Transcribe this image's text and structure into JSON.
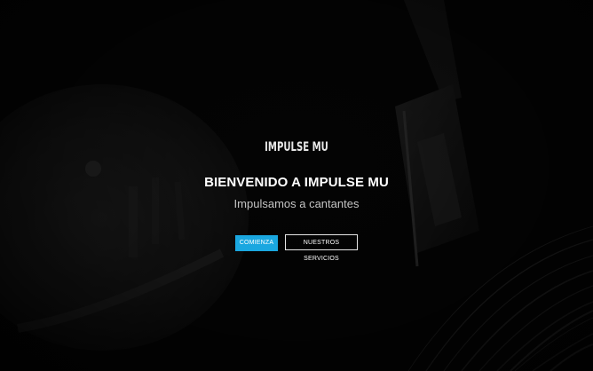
{
  "hero": {
    "logo_text": "IMPULSE MU",
    "headline": "BIENVENIDO A IMPULSE MU",
    "subheadline": "Impulsamos a cantantes",
    "primary_button_label": "COMIENZA",
    "secondary_button_label": "NUESTROS SERVICIOS",
    "background_image": "vinyl-record-turntable-photo"
  },
  "colors": {
    "primary_button": "#1aa7e0",
    "background": "#050505",
    "headline": "#ffffff",
    "subheadline": "#c4c4c4"
  }
}
